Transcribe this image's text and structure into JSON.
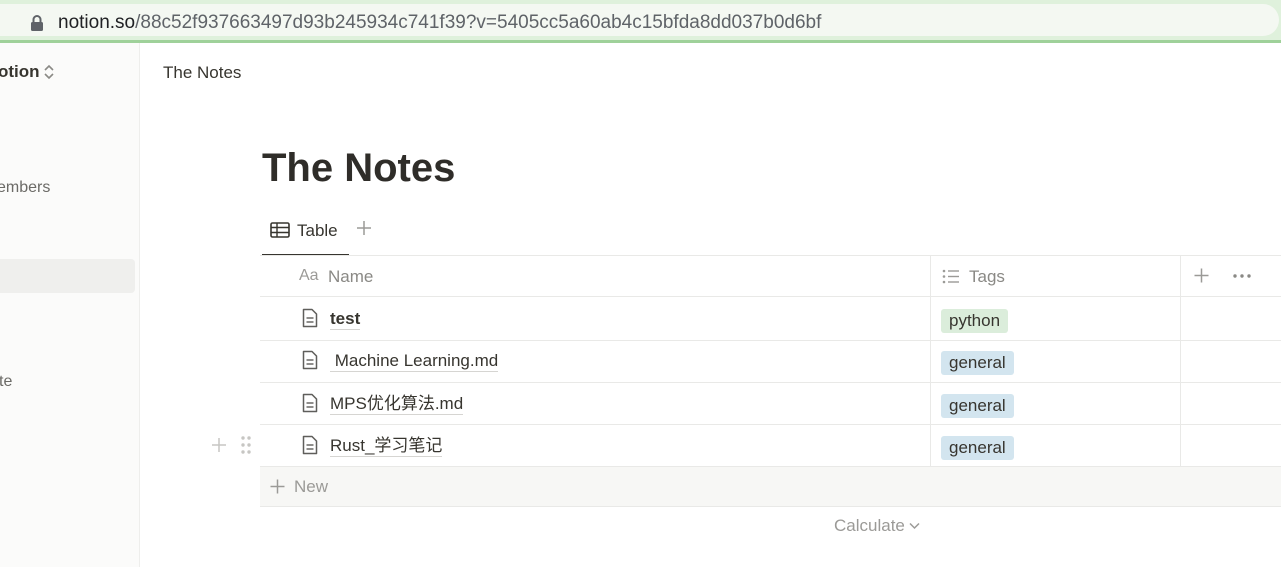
{
  "browser": {
    "url_host": "notion.so",
    "url_path": "/88c52f937663497d93b245934c741f39?v=5405cc5a60ab4c15bfda8dd037b0d6bf"
  },
  "sidebar": {
    "workspace_name": "otion",
    "members_label": "embers",
    "te_label": "te"
  },
  "topbar": {
    "breadcrumb": "The Notes"
  },
  "page": {
    "title": "The Notes"
  },
  "views": {
    "tabs": [
      {
        "label": "Table",
        "icon": "table-icon"
      }
    ]
  },
  "table": {
    "columns": [
      {
        "icon_label": "Aa",
        "label": "Name"
      },
      {
        "icon": "list-icon",
        "label": "Tags"
      }
    ],
    "rows": [
      {
        "name": "test",
        "tag": "python",
        "tag_color": "#dbeddb"
      },
      {
        "name": " Machine Learning.md",
        "tag": "general",
        "tag_color": "#d3e5ef"
      },
      {
        "name": "MPS优化算法.md",
        "tag": "general",
        "tag_color": "#d3e5ef"
      },
      {
        "name": "Rust_学习笔记",
        "tag": "general",
        "tag_color": "#d3e5ef"
      }
    ],
    "new_label": "New",
    "calculate_label": "Calculate"
  },
  "colors": {
    "text": "#37352f",
    "muted": "#9b9a97",
    "tag_green": "#dbeddb",
    "tag_blue": "#d3e5ef",
    "address_bar": "#dff1dc"
  }
}
